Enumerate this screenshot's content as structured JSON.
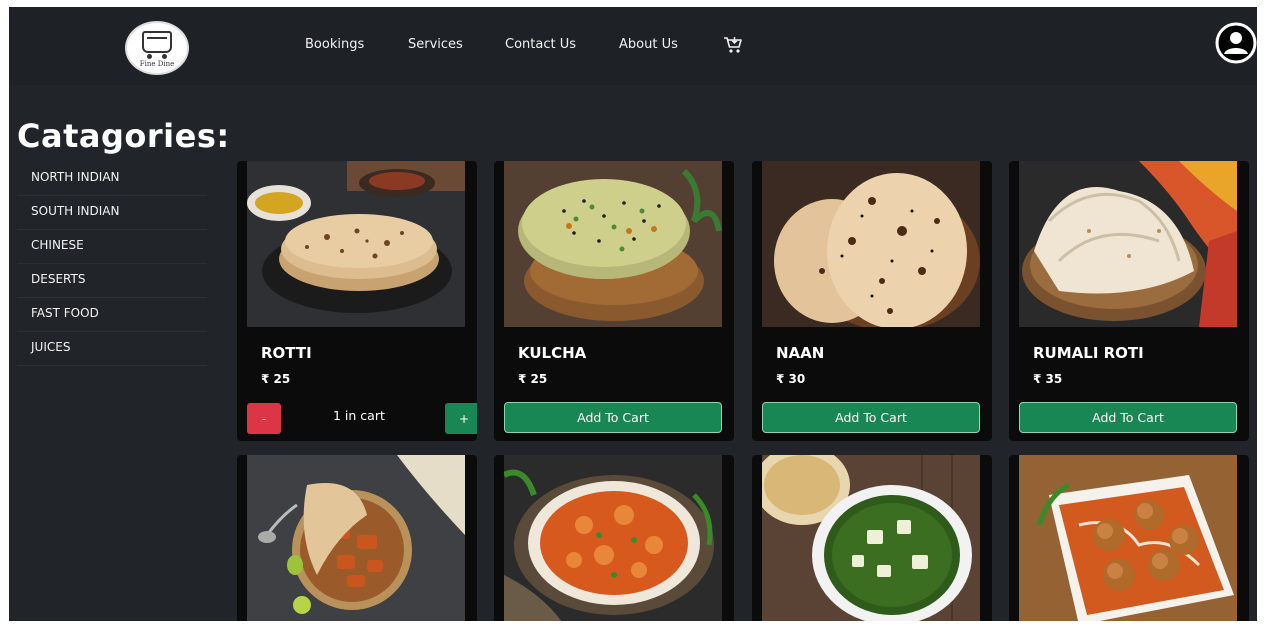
{
  "brand": {
    "logo_text": "Fine Dine"
  },
  "nav": {
    "links": [
      {
        "label": "Bookings"
      },
      {
        "label": "Services"
      },
      {
        "label": "Contact Us"
      },
      {
        "label": "About Us"
      }
    ]
  },
  "sidebar": {
    "title": "Catagories:",
    "items": [
      {
        "label": "NORTH INDIAN"
      },
      {
        "label": "SOUTH INDIAN"
      },
      {
        "label": "CHINESE"
      },
      {
        "label": "DESERTS"
      },
      {
        "label": "FAST FOOD"
      },
      {
        "label": "JUICES"
      }
    ]
  },
  "products": [
    {
      "name": "ROTTI",
      "price": "₹ 25",
      "in_cart_text": "1 in cart",
      "minus_label": "-",
      "plus_label": "+"
    },
    {
      "name": "KULCHA",
      "price": "₹ 25",
      "button_label": "Add To Cart"
    },
    {
      "name": "NAAN",
      "price": "₹ 30",
      "button_label": "Add To Cart"
    },
    {
      "name": "RUMALI ROTI",
      "price": "₹ 35",
      "button_label": "Add To Cart"
    }
  ],
  "icons": {
    "cart": "cart-icon",
    "account": "account-icon"
  },
  "colors": {
    "background": "#212529",
    "card": "#0b0b0b",
    "add_button": "#198754",
    "minus_button": "#dc3545"
  }
}
